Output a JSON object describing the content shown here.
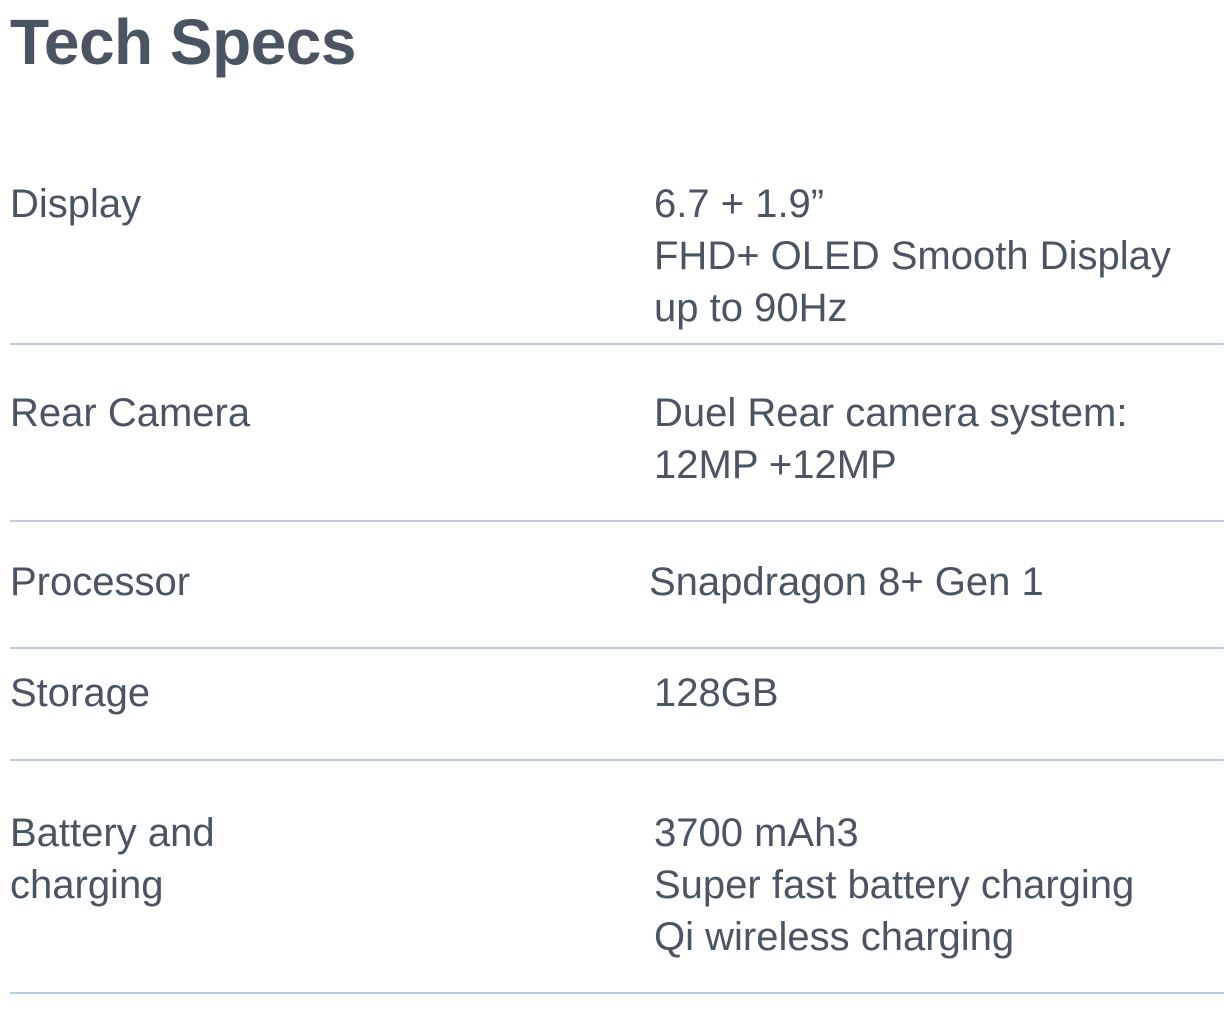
{
  "page": {
    "title": "Tech Specs"
  },
  "specs": [
    {
      "label_lines": [
        "Display"
      ],
      "value_lines": [
        "6.7 + 1.9”",
        "FHD+ OLED Smooth Display",
        "up to 90Hz"
      ]
    },
    {
      "label_lines": [
        "Rear Camera"
      ],
      "value_lines": [
        "Duel Rear camera system:",
        "12MP +12MP"
      ]
    },
    {
      "label_lines": [
        "Processor"
      ],
      "value_lines": [
        "Snapdragon 8+ Gen 1"
      ]
    },
    {
      "label_lines": [
        "Storage"
      ],
      "value_lines": [
        "128GB"
      ]
    },
    {
      "label_lines": [
        "Battery and",
        "charging"
      ],
      "value_lines": [
        "3700 mAh3",
        "Super fast battery charging",
        "Qi wireless charging"
      ]
    }
  ],
  "colors": {
    "text": "#4a5462",
    "divider": "#b9cbe6",
    "background": "#ffffff"
  }
}
